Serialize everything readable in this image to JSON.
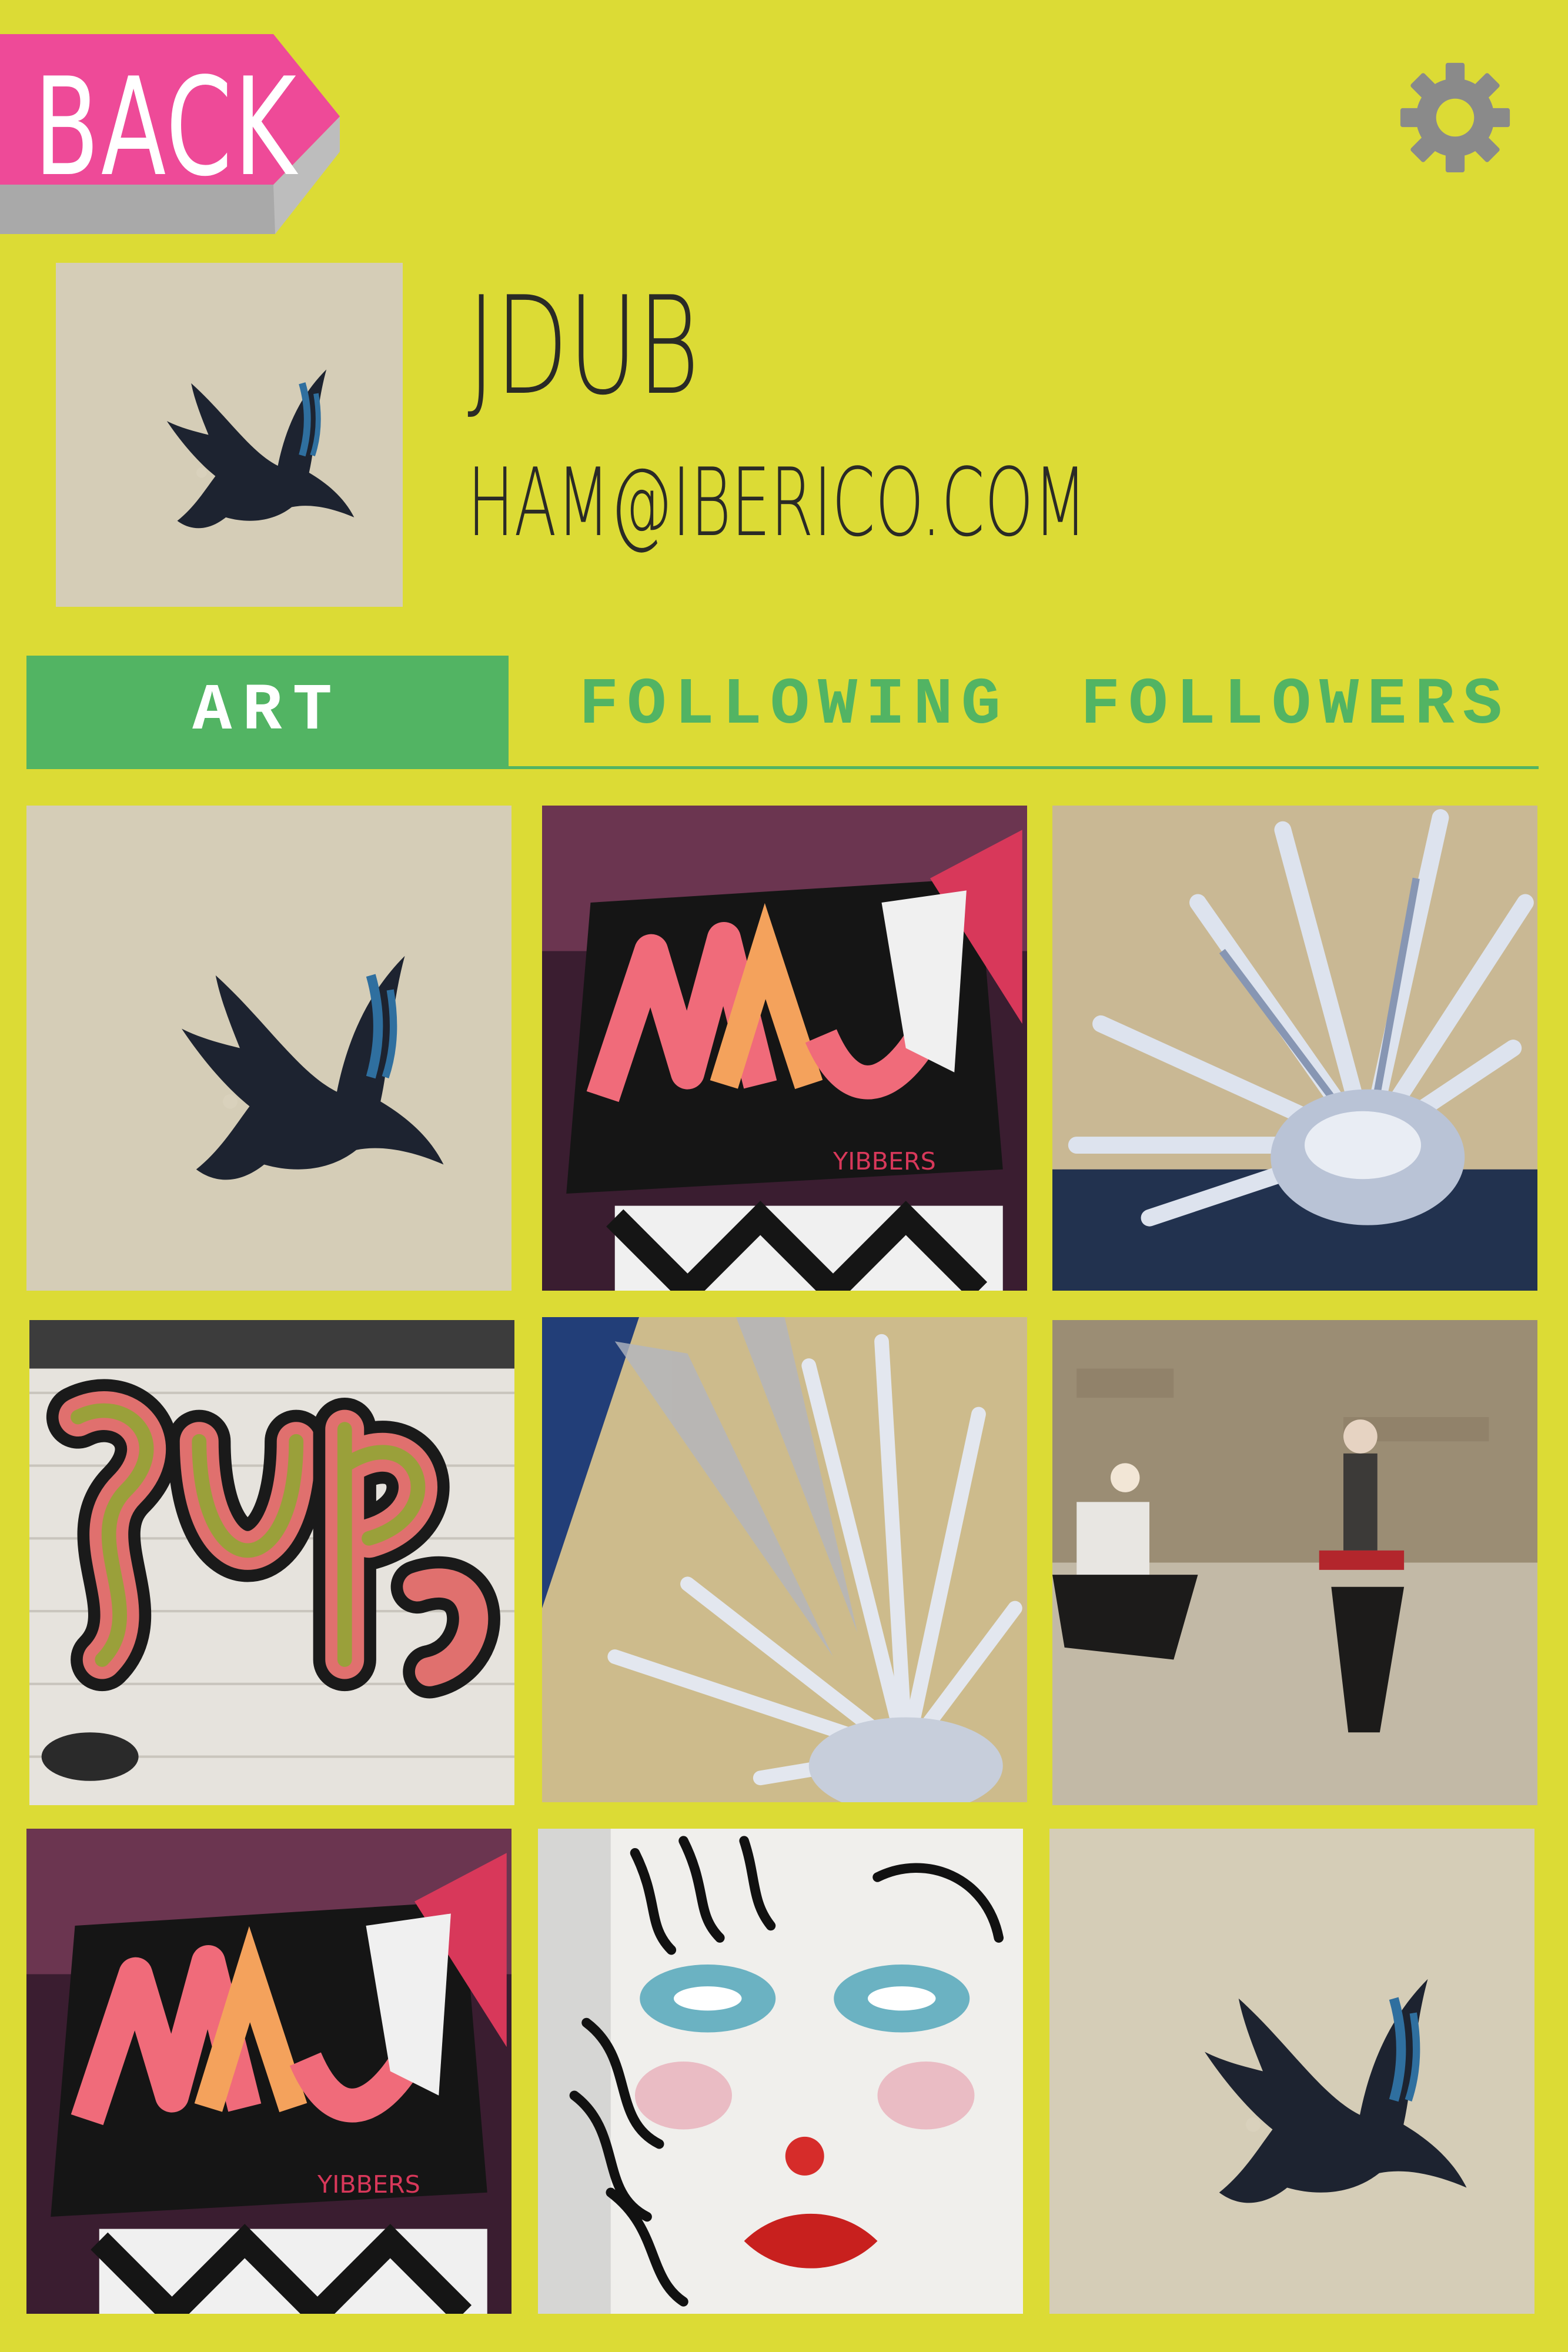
{
  "header": {
    "back_label": "BACK",
    "settings_icon": "gear-icon"
  },
  "profile": {
    "username": "JDUB",
    "email": "HAM@IBERICO.COM",
    "avatar_art": "eagle"
  },
  "tabs": [
    {
      "label": "ART",
      "active": true
    },
    {
      "label": "FOLLOWING",
      "active": false
    },
    {
      "label": "FOLLOWERS",
      "active": false
    }
  ],
  "art_grid": [
    {
      "art": "eagle"
    },
    {
      "art": "graffiti-letters"
    },
    {
      "art": "silver-spikes"
    },
    {
      "art": "bubble-letters"
    },
    {
      "art": "silver-spikes-closeup"
    },
    {
      "art": "figures-on-wall"
    },
    {
      "art": "graffiti-letters"
    },
    {
      "art": "face-portrait"
    },
    {
      "art": "eagle"
    }
  ],
  "colors": {
    "background": "#dcdb35",
    "accent_pink": "#ee4a98",
    "accent_green": "#52b463",
    "text_dark": "#2a2a26",
    "gear_gray": "#8a8a8a"
  }
}
